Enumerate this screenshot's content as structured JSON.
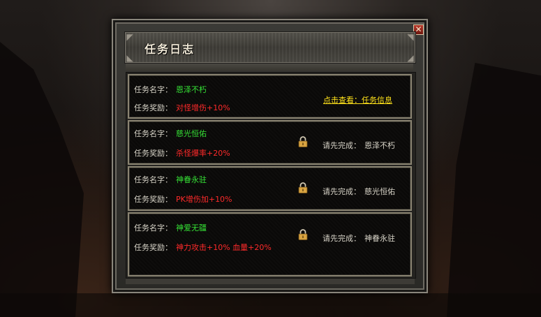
{
  "window": {
    "title": "任务日志",
    "close_label": "✕"
  },
  "tasks": [
    {
      "name_label": "任务名字：",
      "name": "恩泽不朽",
      "reward_label": "任务奖励：",
      "reward": "对怪增伤+10%",
      "locked": false,
      "action": "点击查看：任务信息"
    },
    {
      "name_label": "任务名字：",
      "name": "慈光恒佑",
      "reward_label": "任务奖励：",
      "reward": "杀怪爆率+20%",
      "locked": true,
      "require_label": "请先完成：",
      "require": "恩泽不朽"
    },
    {
      "name_label": "任务名字：",
      "name": "神眷永驻",
      "reward_label": "任务奖励：",
      "reward": "PK增伤加+10%",
      "locked": true,
      "require_label": "请先完成：",
      "require": "慈光恒佑"
    },
    {
      "name_label": "任务名字：",
      "name": "神爱无疆",
      "reward_label": "任务奖励：",
      "reward": "神力攻击+10% 血量+20%",
      "locked": true,
      "require_label": "请先完成：",
      "require": "神眷永驻"
    }
  ],
  "colors": {
    "name": "#35e035",
    "reward": "#ff2a2a",
    "link": "#ffe21a",
    "lock": "#d9a441"
  }
}
